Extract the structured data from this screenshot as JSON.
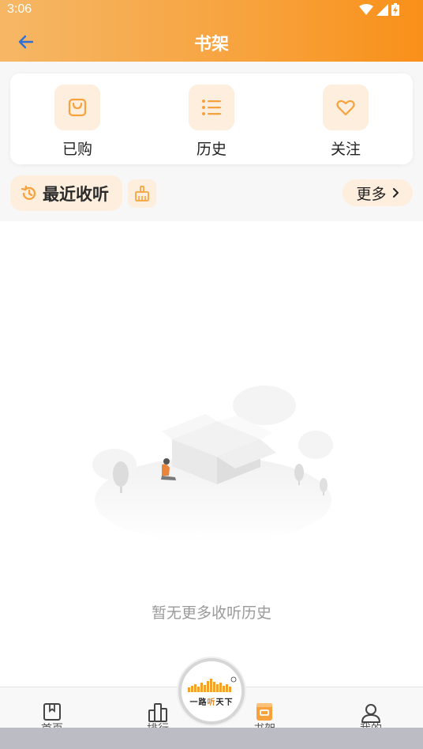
{
  "status_bar": {
    "time": "3:06",
    "icons": [
      "wifi-icon",
      "signal-icon",
      "battery-charging-icon"
    ]
  },
  "header": {
    "title": "书架",
    "back_icon": "arrow-left-icon"
  },
  "quick_actions": [
    {
      "label": "已购",
      "icon": "shopping-bag-icon"
    },
    {
      "label": "历史",
      "icon": "list-icon"
    },
    {
      "label": "关注",
      "icon": "heart-icon"
    }
  ],
  "recent": {
    "title": "最近收听",
    "icon": "history-icon",
    "clean_icon": "broom-icon",
    "more_label": "更多"
  },
  "empty_state": {
    "message": "暂无更多收听历史"
  },
  "tab_bar": {
    "tabs": [
      {
        "label": "首页",
        "icon": "bookmark-book-icon"
      },
      {
        "label": "排行",
        "icon": "ranking-bars-icon"
      },
      {
        "label": "书架",
        "icon": "bookshelf-icon",
        "active": true
      },
      {
        "label": "我的",
        "icon": "user-icon"
      }
    ],
    "center_logo": {
      "line1": "一路",
      "highlight": "听",
      "line2": "天下"
    }
  },
  "colors": {
    "accent": "#f7a23c",
    "accent_light": "#fdeedd",
    "text_muted": "#9a9a9a"
  }
}
